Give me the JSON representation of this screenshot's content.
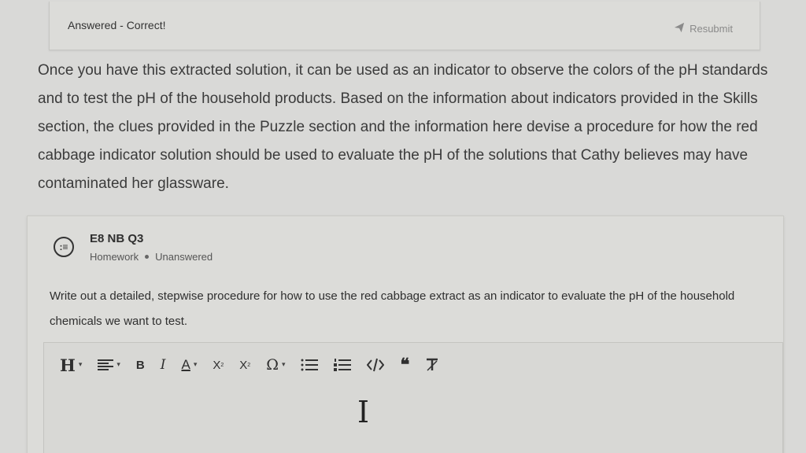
{
  "status_card": {
    "status_text": "Answered - Correct!",
    "resubmit_label": "Resubmit"
  },
  "prompt": {
    "text": "Once you have this extracted solution, it can be used as an indicator to observe the colors of the pH standards and to test the pH of the household products. Based on the information about indicators provided in the Skills section, the clues provided in the Puzzle section and the information here devise a procedure for how the red cabbage indicator solution should be used to evaluate the pH of the solutions that Cathy believes may have contaminated her glassware."
  },
  "question": {
    "icon_glyph": ":≡",
    "title": "E8 NB Q3",
    "type": "Homework",
    "status": "Unanswered",
    "body": "Write out a detailed, stepwise procedure for how to use the red cabbage extract as an indicator to evaluate the pH of the household chemicals we want to test."
  },
  "toolbar": {
    "heading": "H",
    "bold": "B",
    "italic": "I",
    "text_color": "A",
    "subscript_base": "X",
    "subscript_mark": "2",
    "superscript_base": "X",
    "superscript_mark": "2",
    "special_char": "Ω",
    "quote": "❝",
    "caret": "▾"
  },
  "icons": {
    "resubmit": "send-icon",
    "question": "question-type-icon",
    "align": "align-icon",
    "bullet_list": "bullet-list-icon",
    "numbered_list": "numbered-list-icon",
    "code": "code-icon",
    "clear_format": "clear-format-icon",
    "text_cursor": "text-cursor-icon"
  },
  "colors": {
    "background": "#d9d9d7",
    "text": "#3a3a3a"
  }
}
